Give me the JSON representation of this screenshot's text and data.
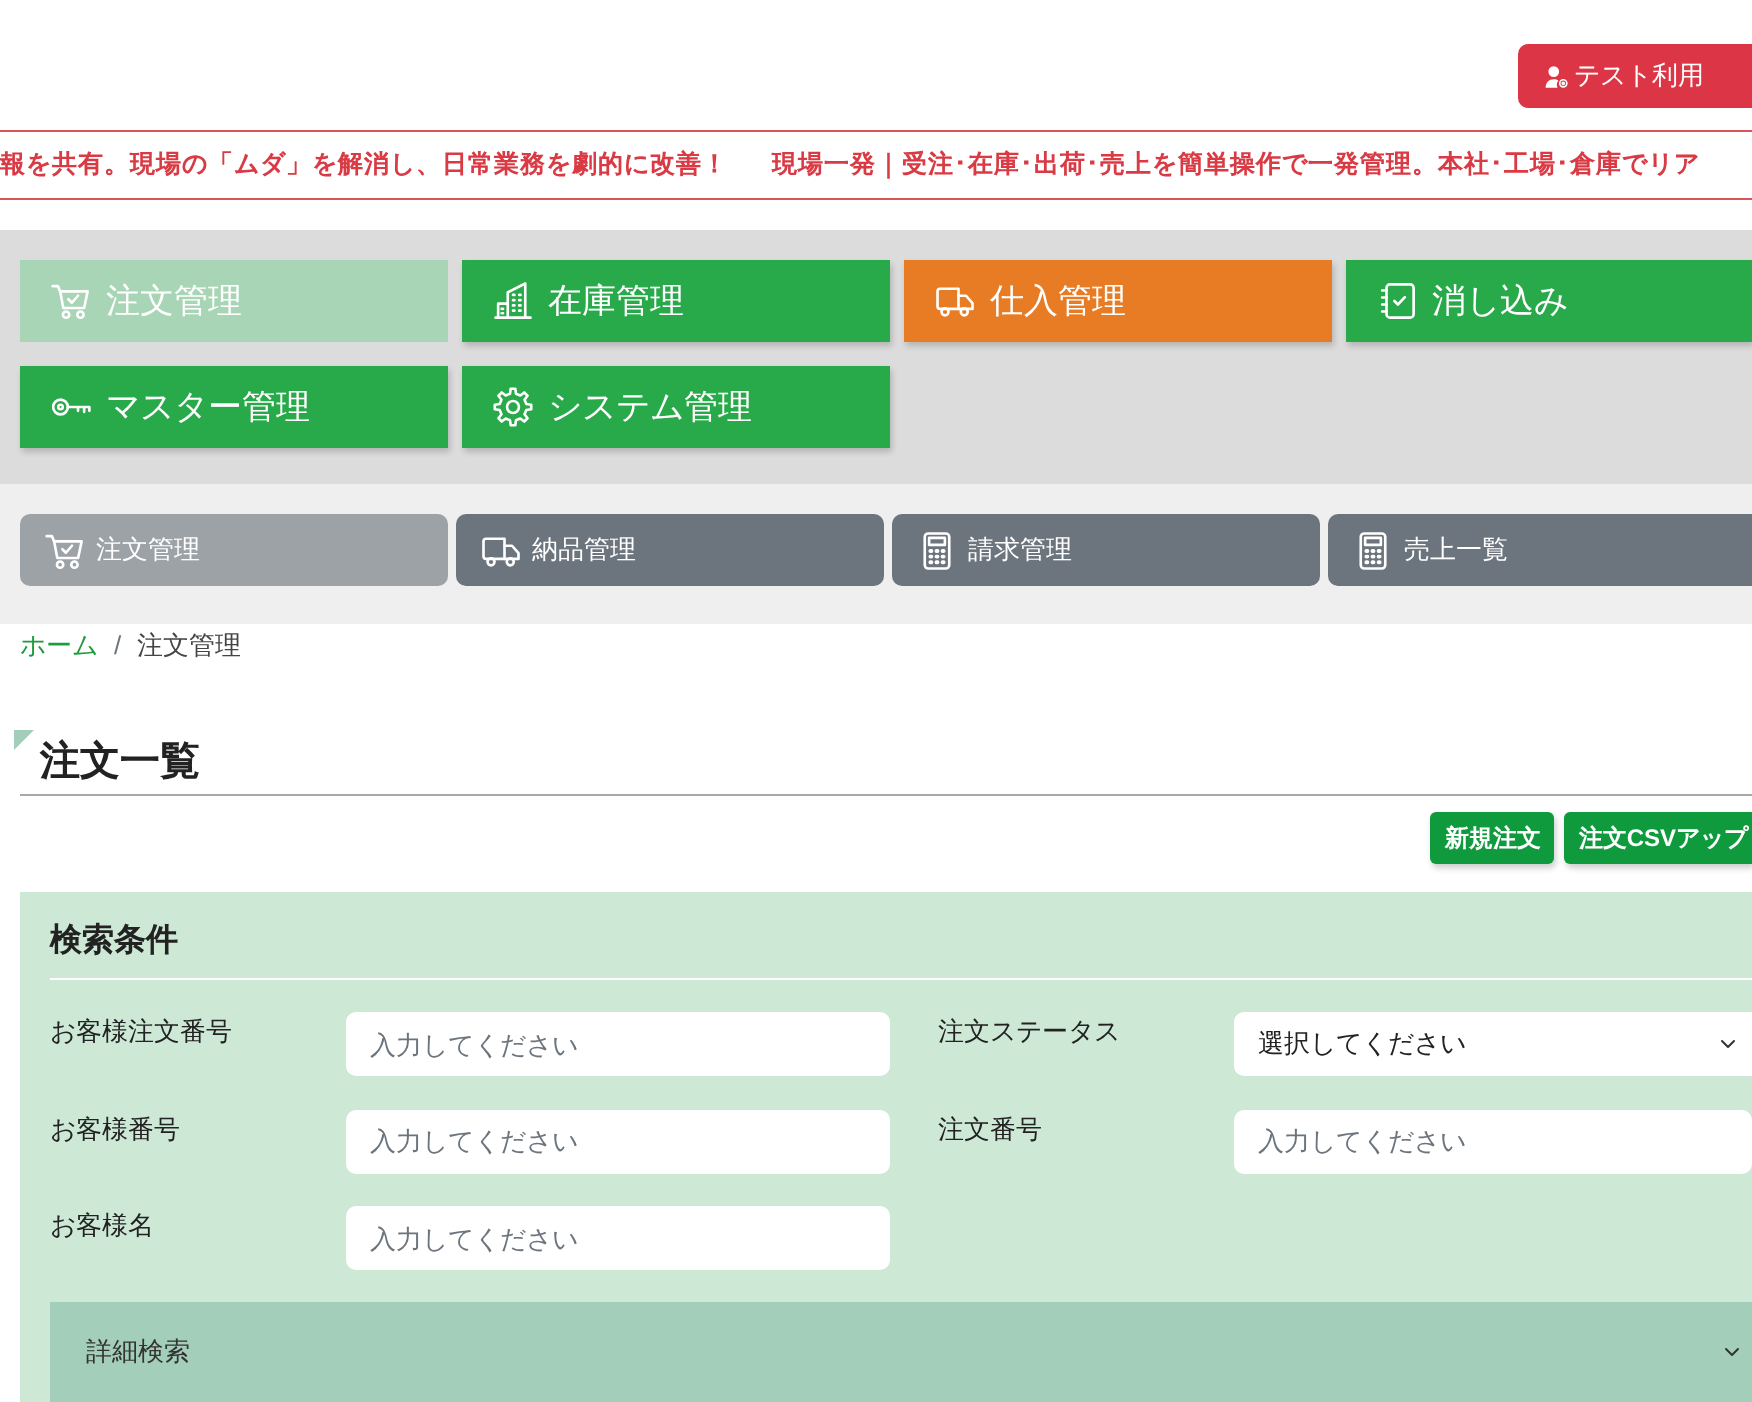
{
  "header": {
    "trial_button": "テスト利用"
  },
  "ticker": {
    "messages": [
      "報を共有。現場の「ムダ」を解消し、日常業務を劇的に改善！",
      "現場一発｜受注･在庫･出荷･売上を簡単操作で一発管理。本社･工場･倉庫でリア"
    ]
  },
  "main_nav": [
    {
      "label": "注文管理",
      "kind": "cart",
      "color": "#a8d5b5",
      "selected": true
    },
    {
      "label": "在庫管理",
      "kind": "building",
      "color": "#28a94a",
      "selected": false
    },
    {
      "label": "仕入管理",
      "kind": "truck",
      "color": "#e87c25",
      "selected": false
    },
    {
      "label": "消し込み",
      "kind": "notebook",
      "color": "#28a94a",
      "selected": false
    },
    {
      "label": "マスター管理",
      "kind": "key",
      "color": "#28a94a",
      "selected": false
    },
    {
      "label": "システム管理",
      "kind": "gear",
      "color": "#28a94a",
      "selected": false
    }
  ],
  "sub_nav": [
    {
      "label": "注文管理",
      "kind": "cart",
      "selected": true
    },
    {
      "label": "納品管理",
      "kind": "truck",
      "selected": false
    },
    {
      "label": "請求管理",
      "kind": "calculator",
      "selected": false
    },
    {
      "label": "売上一覧",
      "kind": "calculator",
      "selected": false
    }
  ],
  "breadcrumb": {
    "items": [
      {
        "label": "ホーム",
        "kind": "link"
      },
      {
        "label": "注文管理",
        "kind": "current"
      }
    ],
    "separator": "/"
  },
  "page_title": "注文一覧",
  "actions": [
    "新規注文",
    "注文CSVアップ"
  ],
  "search": {
    "title": "検索条件",
    "fields": [
      {
        "label": "お客様注文番号",
        "kind": "text",
        "placeholder": "入力してください"
      },
      {
        "label": "注文ステータス",
        "kind": "select",
        "value": "選択してください"
      },
      {
        "label": "お客様番号",
        "kind": "text",
        "placeholder": "入力してください"
      },
      {
        "label": "注文番号",
        "kind": "text",
        "placeholder": "入力してください"
      },
      {
        "label": "お客様名",
        "kind": "text",
        "placeholder": "入力してください"
      }
    ],
    "detail": {
      "label": "詳細検索",
      "expanded": false
    }
  }
}
